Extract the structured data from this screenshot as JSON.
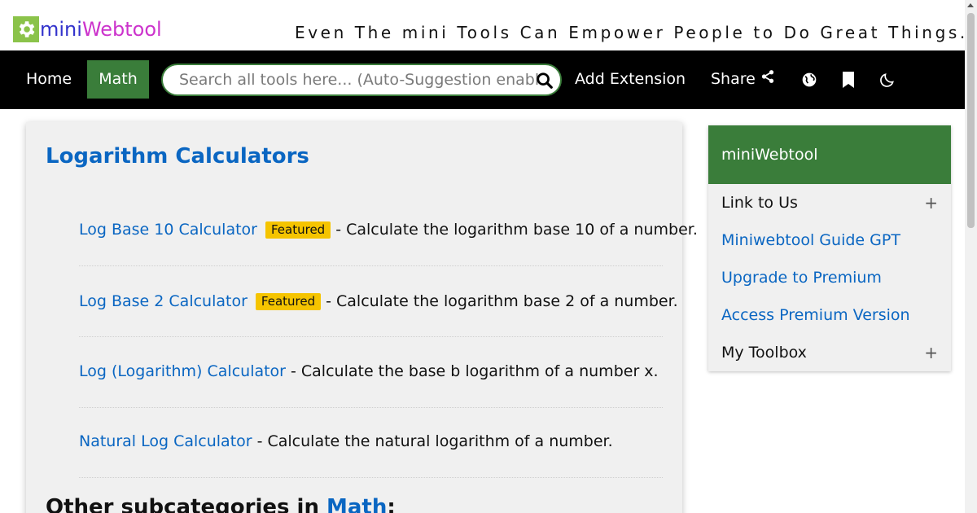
{
  "brand": {
    "logo_mini": "mini",
    "logo_web": "Webtool",
    "tagline": "Even The mini Tools Can Empower People to Do Great Things.",
    "colors": {
      "logo_icon": "#8bc34a",
      "mini": "#3333cc",
      "webtool": "#cc33cc"
    }
  },
  "nav": {
    "home": "Home",
    "math": "Math",
    "search_placeholder": "Search all tools here... (Auto-Suggestion enabled)",
    "add_extension": "Add Extension",
    "share": "Share",
    "icons": [
      "share-icon",
      "globe-icon",
      "bookmark-icon",
      "moon-icon",
      "search-icon"
    ],
    "colors": {
      "bar": "#000000",
      "active": "#3a7d3a"
    }
  },
  "main": {
    "title": "Logarithm Calculators",
    "tools": [
      {
        "name": "Log Base 10 Calculator",
        "badge": "Featured",
        "desc": "- Calculate the logarithm base 10 of a number."
      },
      {
        "name": "Log Base 2 Calculator",
        "badge": "Featured",
        "desc": "- Calculate the logarithm base 2 of a number."
      },
      {
        "name": "Log (Logarithm) Calculator",
        "badge": "",
        "desc": "- Calculate the base b logarithm of a number x."
      },
      {
        "name": "Natural Log Calculator",
        "badge": "",
        "desc": "- Calculate the natural logarithm of a number."
      }
    ],
    "other_prefix": "Other subcategories in ",
    "other_link": "Math",
    "other_suffix": ":"
  },
  "sidebar": {
    "header": "miniWebtool",
    "items": [
      {
        "label": "Link to Us",
        "expandable": "+"
      },
      {
        "label": "Miniwebtool Guide GPT"
      },
      {
        "label": "Upgrade to Premium"
      },
      {
        "label": "Access Premium Version"
      },
      {
        "label": "My Toolbox",
        "expandable": "+"
      }
    ]
  }
}
